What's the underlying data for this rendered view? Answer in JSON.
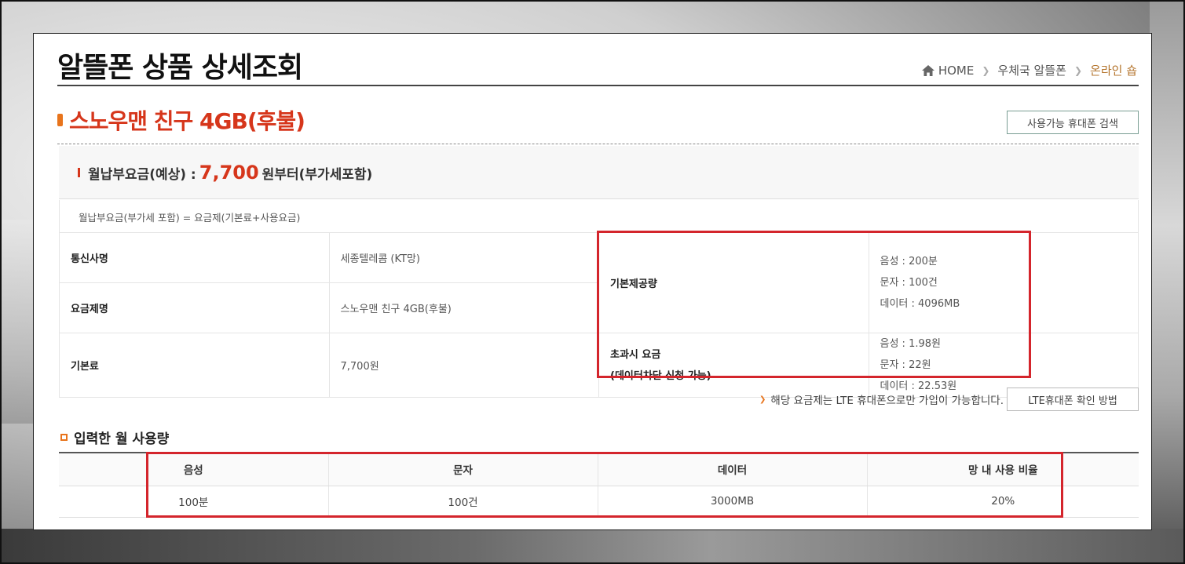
{
  "header": {
    "page_title": "알뜰폰 상품 상세조회",
    "breadcrumb": [
      "HOME",
      "우체국 알뜰폰",
      "온라인 숍"
    ]
  },
  "product": {
    "title": "스노우맨 친구 4GB(후불)",
    "phone_search_button": "사용가능 휴대폰 검색"
  },
  "fee": {
    "label": "월납부요금(예상) :",
    "amount": "7,700",
    "suffix": "원부터(부가세포함)",
    "note": "월납부요금(부가세 포함) = 요금제(기본료+사용요금)"
  },
  "info": {
    "carrier_label": "통신사명",
    "carrier_value": "세종텔레콤 (KT망)",
    "plan_label": "요금제명",
    "plan_value": "스노우맨 친구 4GB(후불)",
    "base_label": "기본료",
    "base_value": "7,700원",
    "provided_label": "기본제공량",
    "provided": [
      "음성 : 200분",
      "문자 : 100건",
      "데이터 : 4096MB"
    ],
    "overage_label_1": "초과시 요금",
    "overage_label_2": "(데이터차단 신청 가능)",
    "overage": [
      "음성 : 1.98원",
      "문자 : 22원",
      "데이터 : 22.53원"
    ]
  },
  "lte": {
    "note": "해당 요금제는 LTE 휴대폰으로만 가입이 가능합니다.",
    "button": "LTE휴대폰 확인 방법"
  },
  "usage": {
    "section_title": "입력한 월 사용량",
    "headers": [
      "음성",
      "문자",
      "데이터",
      "망 내 사용 비율"
    ],
    "values": [
      "100분",
      "100건",
      "3000MB",
      "20%"
    ]
  },
  "colors": {
    "accent_red": "#d6361b",
    "highlight_box": "#d4252c",
    "orange": "#e8741c"
  }
}
